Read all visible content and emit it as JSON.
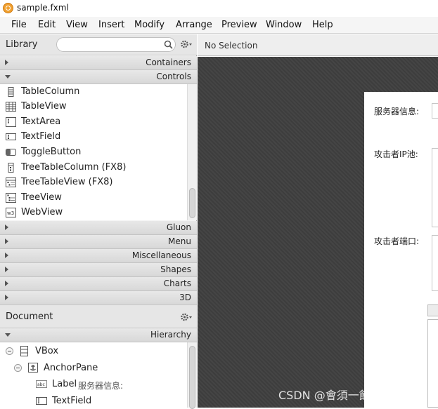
{
  "window": {
    "title": "sample.fxml"
  },
  "menu": [
    "File",
    "Edit",
    "View",
    "Insert",
    "Modify",
    "Arrange",
    "Preview",
    "Window",
    "Help"
  ],
  "library": {
    "title": "Library",
    "categories_top": [
      {
        "label": "Containers",
        "expanded": false
      },
      {
        "label": "Controls",
        "expanded": true
      }
    ],
    "controls_items": [
      {
        "label": "TableColumn",
        "icon": "table-column-icon"
      },
      {
        "label": "TableView",
        "icon": "table-view-icon"
      },
      {
        "label": "TextArea",
        "icon": "text-area-icon"
      },
      {
        "label": "TextField",
        "icon": "text-field-icon"
      },
      {
        "label": "ToggleButton",
        "icon": "toggle-button-icon"
      },
      {
        "label": "TreeTableColumn   (FX8)",
        "icon": "tree-table-column-icon"
      },
      {
        "label": "TreeTableView   (FX8)",
        "icon": "tree-table-view-icon"
      },
      {
        "label": "TreeView",
        "icon": "tree-view-icon"
      },
      {
        "label": "WebView",
        "icon": "web-view-icon"
      }
    ],
    "categories_bottom": [
      {
        "label": "Gluon"
      },
      {
        "label": "Menu"
      },
      {
        "label": "Miscellaneous"
      },
      {
        "label": "Shapes"
      },
      {
        "label": "Charts"
      },
      {
        "label": "3D"
      }
    ]
  },
  "document": {
    "title": "Document",
    "hierarchy_label": "Hierarchy",
    "tree": [
      {
        "label": "VBox",
        "detail": "",
        "icon": "vbox-icon"
      },
      {
        "label": "AnchorPane",
        "detail": "",
        "icon": "anchor-pane-icon"
      },
      {
        "label": "Label",
        "detail": "服务器信息:",
        "icon": "label-icon"
      },
      {
        "label": "TextField",
        "detail": "",
        "icon": "text-field-icon"
      }
    ]
  },
  "selection": {
    "text": "No Selection"
  },
  "form": {
    "labels": [
      "服务器信息:",
      "攻击者IP池:",
      "攻击者端口:"
    ]
  },
  "watermark": "CSDN @會須一飲三百杯"
}
